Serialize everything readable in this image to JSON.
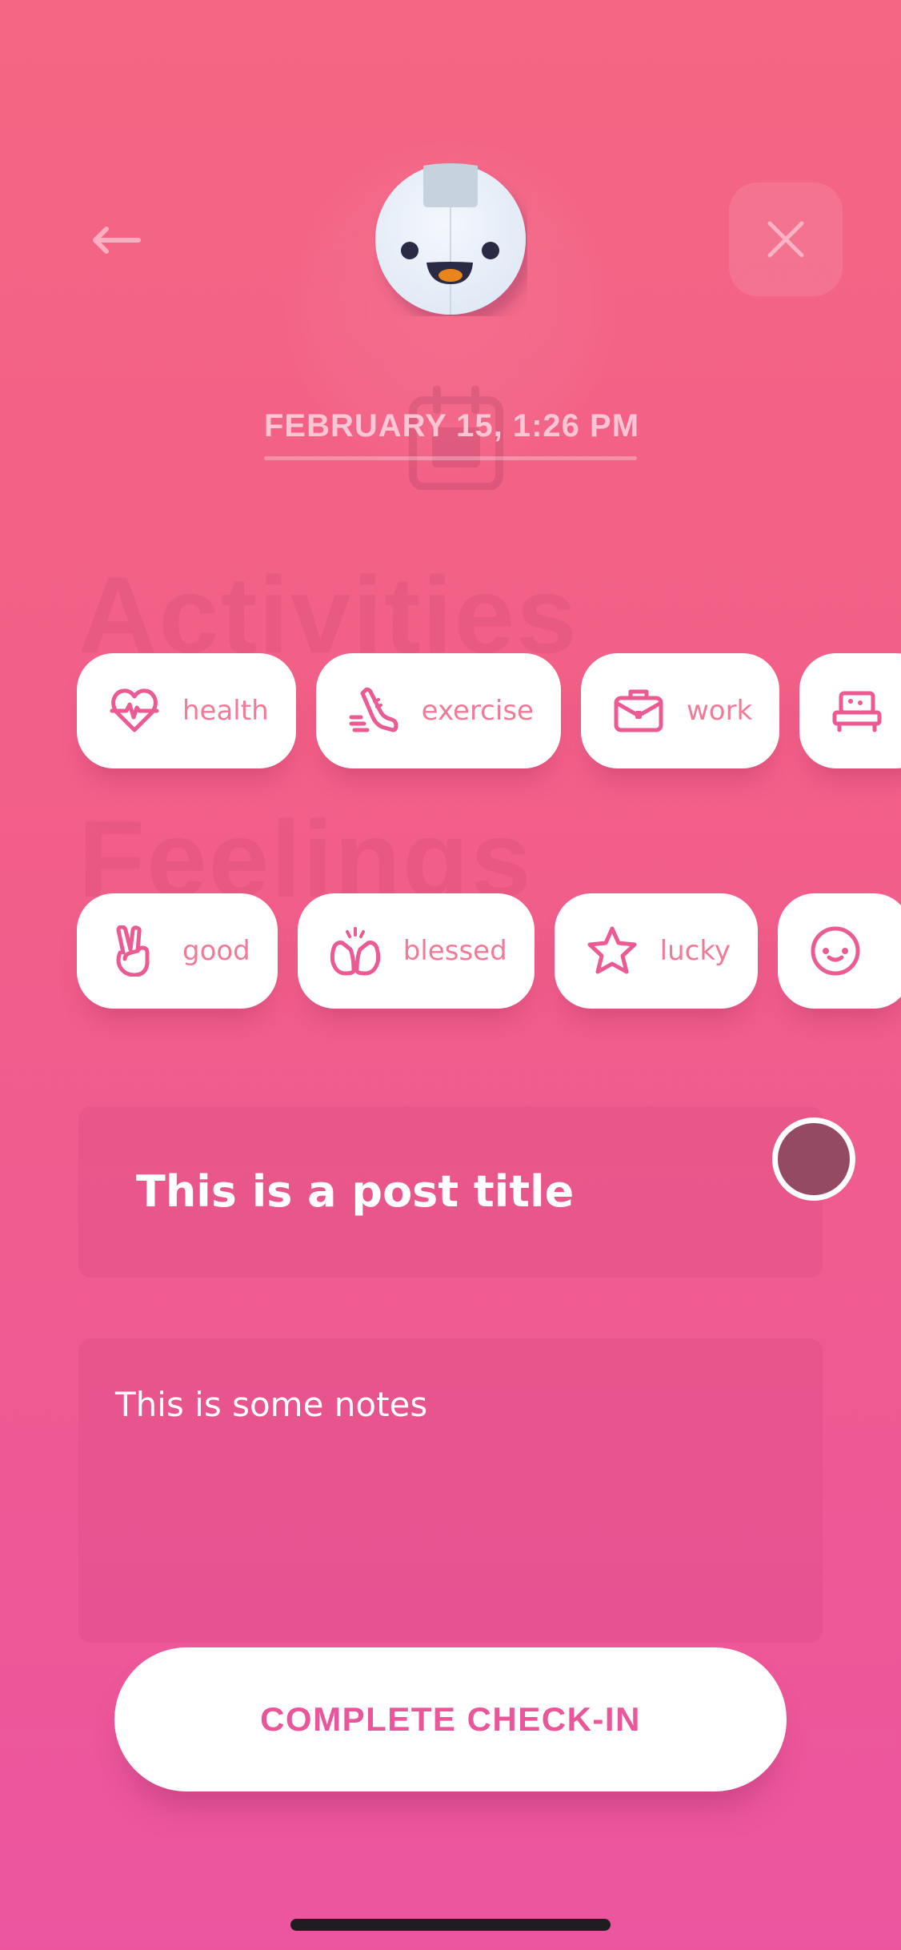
{
  "screen": "check-in-details",
  "nav": {
    "back_icon": "arrow-left-icon",
    "close_icon": "close-x-icon"
  },
  "mascot": {
    "icon": "smiling-robot-face-mascot",
    "mood": "happy"
  },
  "date": {
    "label": "FEBRUARY 15,  1:26 PM",
    "background_icon": "calendar-icon"
  },
  "activities": {
    "heading": "Activities",
    "items": [
      {
        "label": "health",
        "icon": "heart-pulse-icon"
      },
      {
        "label": "exercise",
        "icon": "running-shoe-icon"
      },
      {
        "label": "work",
        "icon": "briefcase-icon"
      },
      {
        "label": "",
        "icon": "bed-icon"
      }
    ]
  },
  "feelings": {
    "heading": "Feelings",
    "items": [
      {
        "label": "good",
        "icon": "peace-hand-icon"
      },
      {
        "label": "blessed",
        "icon": "raised-hands-icon"
      },
      {
        "label": "lucky",
        "icon": "star-icon"
      },
      {
        "label": "",
        "icon": "smiley-face-icon"
      }
    ]
  },
  "post": {
    "title": "This is a post title",
    "color_swatch": "#944a63",
    "notes": "This is some notes"
  },
  "actions": {
    "complete_label": "COMPLETE CHECK-IN"
  },
  "colors": {
    "bg_top": "#f46684",
    "bg_bottom": "#ec55a0",
    "accent_pink": "#ec5a93",
    "chip_text": "#f07b97",
    "button_text": "#e9569a"
  }
}
